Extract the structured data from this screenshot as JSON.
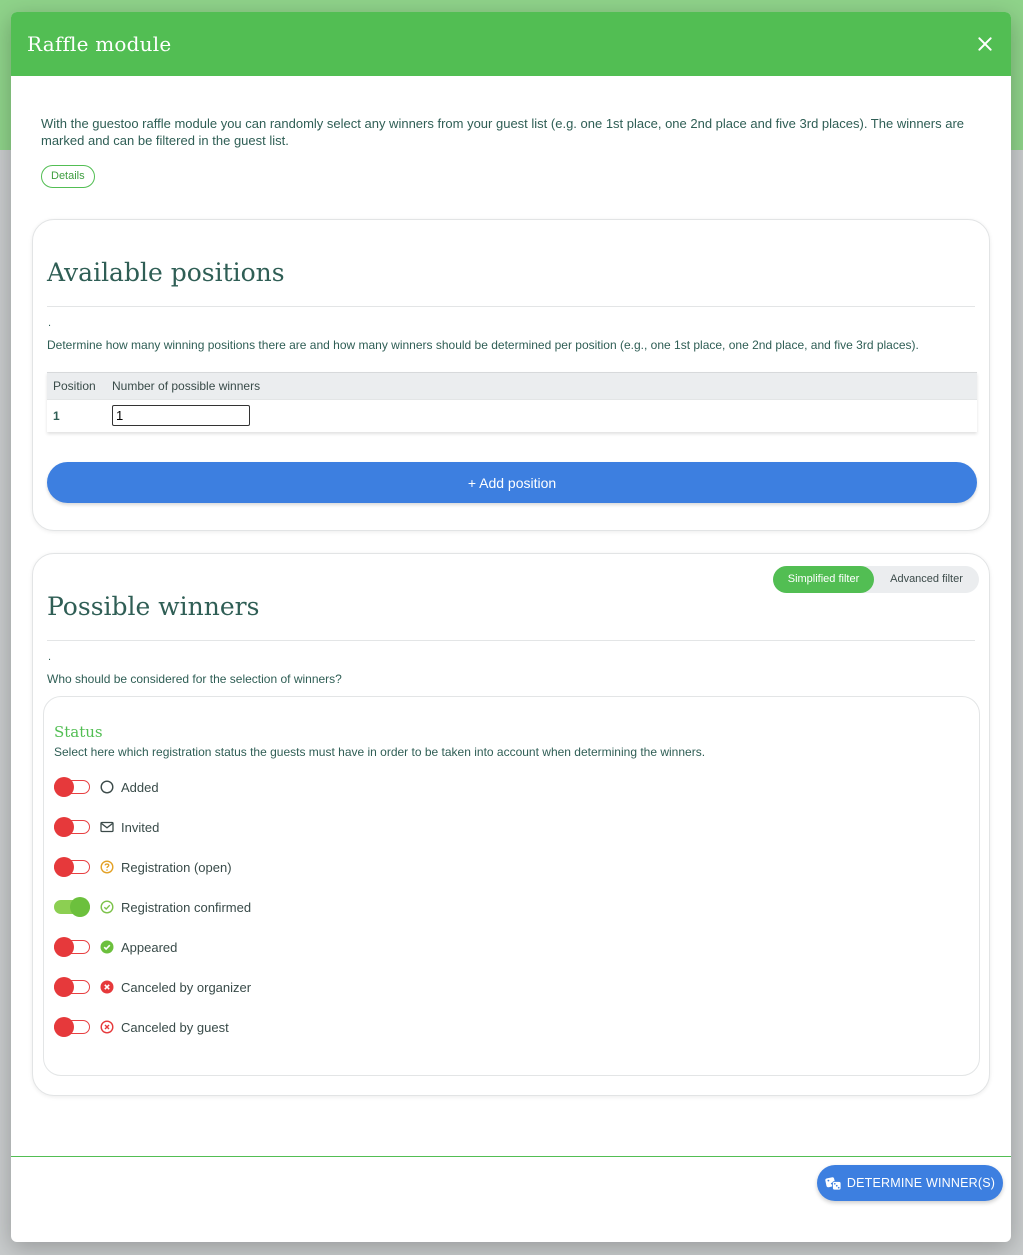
{
  "modal": {
    "title": "Raffle module",
    "intro": "With the guestoo raffle module you can randomly select any winners from your guest list (e.g. one 1st place, one 2nd place and five 3rd places). The winners are marked and can be filtered in the guest list.",
    "details_label": "Details"
  },
  "positions": {
    "title": "Available positions",
    "dot": ".",
    "description": "Determine how many winning positions there are and how many winners should be determined per position (e.g., one 1st place, one 2nd place, and five 3rd places).",
    "columns": [
      "Position",
      "Number of possible winners"
    ],
    "rows": [
      {
        "position": "1",
        "winners": "1"
      }
    ],
    "add_label": "+ Add position"
  },
  "winners": {
    "title": "Possible winners",
    "dot": ".",
    "description": "Who should be considered for the selection of winners?",
    "filter": {
      "simplified": "Simplified filter",
      "advanced": "Advanced filter",
      "active": "simplified"
    },
    "status": {
      "title": "Status",
      "description": "Select here which registration status the guests must have in order to be taken into account when determining the winners.",
      "items": [
        {
          "label": "Added",
          "icon": "circle-outline-icon",
          "enabled": false
        },
        {
          "label": "Invited",
          "icon": "envelope-icon",
          "enabled": false
        },
        {
          "label": "Registration (open)",
          "icon": "question-circle-icon",
          "enabled": false
        },
        {
          "label": "Registration confirmed",
          "icon": "check-circle-outline-icon",
          "enabled": true
        },
        {
          "label": "Appeared",
          "icon": "check-circle-filled-icon",
          "enabled": false
        },
        {
          "label": "Canceled by organizer",
          "icon": "x-circle-filled-icon",
          "enabled": false
        },
        {
          "label": "Canceled by guest",
          "icon": "x-circle-outline-icon",
          "enabled": false
        }
      ]
    }
  },
  "footer": {
    "determine_label": "DETERMINE WINNER(S)",
    "determine_icon": "dice-icon"
  },
  "colors": {
    "brand_green": "#52be53",
    "title_text": "#2f5e55",
    "primary_blue": "#3d7fe0",
    "toggle_off": "#e6393b",
    "toggle_on": "#6cc03d"
  }
}
